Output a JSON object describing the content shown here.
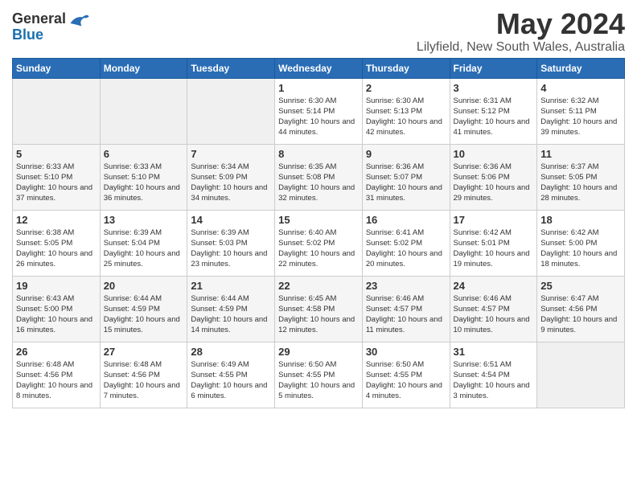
{
  "logo": {
    "general": "General",
    "blue": "Blue"
  },
  "title": "May 2024",
  "location": "Lilyfield, New South Wales, Australia",
  "days_of_week": [
    "Sunday",
    "Monday",
    "Tuesday",
    "Wednesday",
    "Thursday",
    "Friday",
    "Saturday"
  ],
  "weeks": [
    [
      {
        "day": "",
        "info": ""
      },
      {
        "day": "",
        "info": ""
      },
      {
        "day": "",
        "info": ""
      },
      {
        "day": "1",
        "info": "Sunrise: 6:30 AM\nSunset: 5:14 PM\nDaylight: 10 hours\nand 44 minutes."
      },
      {
        "day": "2",
        "info": "Sunrise: 6:30 AM\nSunset: 5:13 PM\nDaylight: 10 hours\nand 42 minutes."
      },
      {
        "day": "3",
        "info": "Sunrise: 6:31 AM\nSunset: 5:12 PM\nDaylight: 10 hours\nand 41 minutes."
      },
      {
        "day": "4",
        "info": "Sunrise: 6:32 AM\nSunset: 5:11 PM\nDaylight: 10 hours\nand 39 minutes."
      }
    ],
    [
      {
        "day": "5",
        "info": "Sunrise: 6:33 AM\nSunset: 5:10 PM\nDaylight: 10 hours\nand 37 minutes."
      },
      {
        "day": "6",
        "info": "Sunrise: 6:33 AM\nSunset: 5:10 PM\nDaylight: 10 hours\nand 36 minutes."
      },
      {
        "day": "7",
        "info": "Sunrise: 6:34 AM\nSunset: 5:09 PM\nDaylight: 10 hours\nand 34 minutes."
      },
      {
        "day": "8",
        "info": "Sunrise: 6:35 AM\nSunset: 5:08 PM\nDaylight: 10 hours\nand 32 minutes."
      },
      {
        "day": "9",
        "info": "Sunrise: 6:36 AM\nSunset: 5:07 PM\nDaylight: 10 hours\nand 31 minutes."
      },
      {
        "day": "10",
        "info": "Sunrise: 6:36 AM\nSunset: 5:06 PM\nDaylight: 10 hours\nand 29 minutes."
      },
      {
        "day": "11",
        "info": "Sunrise: 6:37 AM\nSunset: 5:05 PM\nDaylight: 10 hours\nand 28 minutes."
      }
    ],
    [
      {
        "day": "12",
        "info": "Sunrise: 6:38 AM\nSunset: 5:05 PM\nDaylight: 10 hours\nand 26 minutes."
      },
      {
        "day": "13",
        "info": "Sunrise: 6:39 AM\nSunset: 5:04 PM\nDaylight: 10 hours\nand 25 minutes."
      },
      {
        "day": "14",
        "info": "Sunrise: 6:39 AM\nSunset: 5:03 PM\nDaylight: 10 hours\nand 23 minutes."
      },
      {
        "day": "15",
        "info": "Sunrise: 6:40 AM\nSunset: 5:02 PM\nDaylight: 10 hours\nand 22 minutes."
      },
      {
        "day": "16",
        "info": "Sunrise: 6:41 AM\nSunset: 5:02 PM\nDaylight: 10 hours\nand 20 minutes."
      },
      {
        "day": "17",
        "info": "Sunrise: 6:42 AM\nSunset: 5:01 PM\nDaylight: 10 hours\nand 19 minutes."
      },
      {
        "day": "18",
        "info": "Sunrise: 6:42 AM\nSunset: 5:00 PM\nDaylight: 10 hours\nand 18 minutes."
      }
    ],
    [
      {
        "day": "19",
        "info": "Sunrise: 6:43 AM\nSunset: 5:00 PM\nDaylight: 10 hours\nand 16 minutes."
      },
      {
        "day": "20",
        "info": "Sunrise: 6:44 AM\nSunset: 4:59 PM\nDaylight: 10 hours\nand 15 minutes."
      },
      {
        "day": "21",
        "info": "Sunrise: 6:44 AM\nSunset: 4:59 PM\nDaylight: 10 hours\nand 14 minutes."
      },
      {
        "day": "22",
        "info": "Sunrise: 6:45 AM\nSunset: 4:58 PM\nDaylight: 10 hours\nand 12 minutes."
      },
      {
        "day": "23",
        "info": "Sunrise: 6:46 AM\nSunset: 4:57 PM\nDaylight: 10 hours\nand 11 minutes."
      },
      {
        "day": "24",
        "info": "Sunrise: 6:46 AM\nSunset: 4:57 PM\nDaylight: 10 hours\nand 10 minutes."
      },
      {
        "day": "25",
        "info": "Sunrise: 6:47 AM\nSunset: 4:56 PM\nDaylight: 10 hours\nand 9 minutes."
      }
    ],
    [
      {
        "day": "26",
        "info": "Sunrise: 6:48 AM\nSunset: 4:56 PM\nDaylight: 10 hours\nand 8 minutes."
      },
      {
        "day": "27",
        "info": "Sunrise: 6:48 AM\nSunset: 4:56 PM\nDaylight: 10 hours\nand 7 minutes."
      },
      {
        "day": "28",
        "info": "Sunrise: 6:49 AM\nSunset: 4:55 PM\nDaylight: 10 hours\nand 6 minutes."
      },
      {
        "day": "29",
        "info": "Sunrise: 6:50 AM\nSunset: 4:55 PM\nDaylight: 10 hours\nand 5 minutes."
      },
      {
        "day": "30",
        "info": "Sunrise: 6:50 AM\nSunset: 4:55 PM\nDaylight: 10 hours\nand 4 minutes."
      },
      {
        "day": "31",
        "info": "Sunrise: 6:51 AM\nSunset: 4:54 PM\nDaylight: 10 hours\nand 3 minutes."
      },
      {
        "day": "",
        "info": ""
      }
    ]
  ]
}
